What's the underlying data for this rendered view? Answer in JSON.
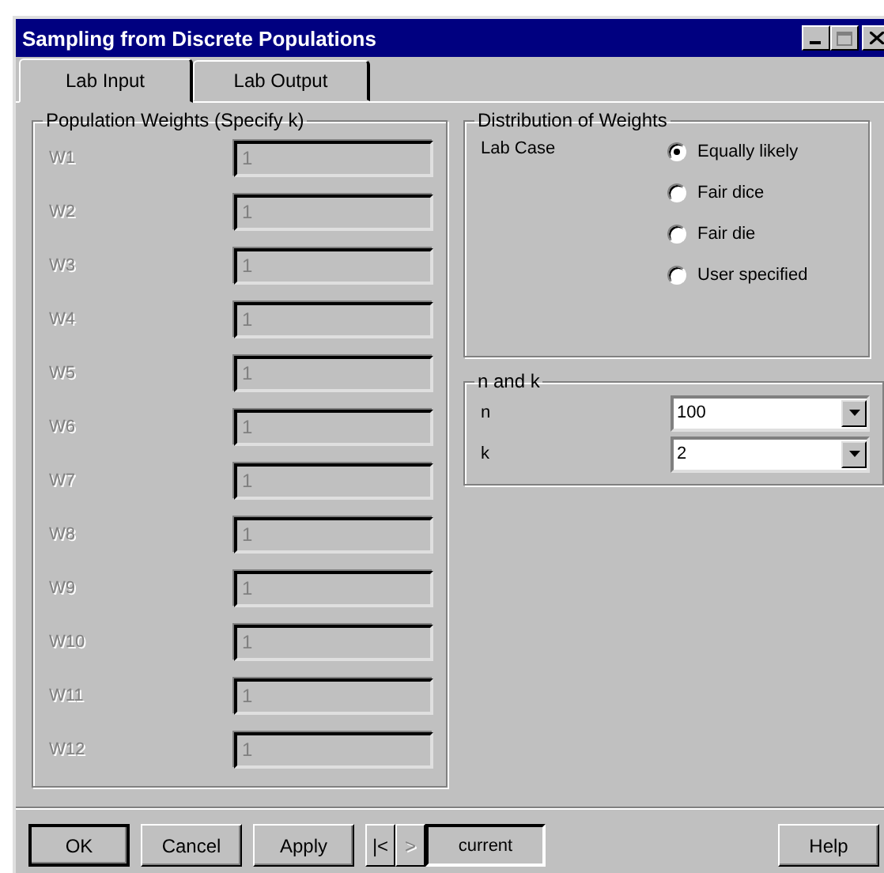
{
  "window": {
    "title": "Sampling from Discrete Populations"
  },
  "tabs": [
    {
      "label": "Lab Input",
      "selected": true
    },
    {
      "label": "Lab Output",
      "selected": false
    }
  ],
  "population_weights": {
    "title": "Population Weights (Specify k)",
    "rows": [
      {
        "label": "W1",
        "value": "1",
        "disabled": true
      },
      {
        "label": "W2",
        "value": "1",
        "disabled": true
      },
      {
        "label": "W3",
        "value": "1",
        "disabled": true
      },
      {
        "label": "W4",
        "value": "1",
        "disabled": true
      },
      {
        "label": "W5",
        "value": "1",
        "disabled": true
      },
      {
        "label": "W6",
        "value": "1",
        "disabled": true
      },
      {
        "label": "W7",
        "value": "1",
        "disabled": true
      },
      {
        "label": "W8",
        "value": "1",
        "disabled": true
      },
      {
        "label": "W9",
        "value": "1",
        "disabled": true
      },
      {
        "label": "W10",
        "value": "1",
        "disabled": true
      },
      {
        "label": "W11",
        "value": "1",
        "disabled": true
      },
      {
        "label": "W12",
        "value": "1",
        "disabled": true
      }
    ]
  },
  "distribution": {
    "title": "Distribution of Weights",
    "label": "Lab Case",
    "options": [
      {
        "label": "Equally likely",
        "selected": true
      },
      {
        "label": "Fair dice",
        "selected": false
      },
      {
        "label": "Fair die",
        "selected": false
      },
      {
        "label": "User specified",
        "selected": false
      }
    ]
  },
  "n_and_k": {
    "title": "n and k",
    "fields": [
      {
        "label": "n",
        "value": "100"
      },
      {
        "label": "k",
        "value": "2"
      }
    ]
  },
  "buttons": [
    {
      "kind": "button",
      "label": "OK",
      "default": true
    },
    {
      "kind": "button",
      "label": "Cancel",
      "default": false
    },
    {
      "kind": "button",
      "label": "Apply",
      "default": false
    },
    {
      "kind": "nav",
      "label": "|<",
      "disabled": false
    },
    {
      "kind": "nav",
      "label": ">",
      "disabled": true
    },
    {
      "kind": "field",
      "label": "current"
    },
    {
      "kind": "spacer"
    },
    {
      "kind": "button",
      "label": "Help",
      "default": false
    }
  ]
}
